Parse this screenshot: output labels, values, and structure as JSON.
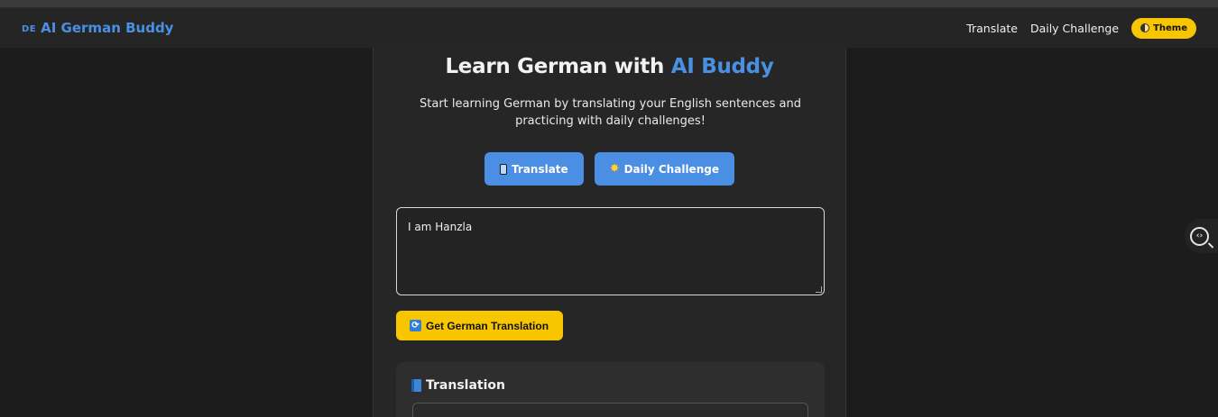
{
  "nav": {
    "brand_flag": "DE",
    "brand_name": "AI German Buddy",
    "links": [
      "Translate",
      "Daily Challenge"
    ],
    "theme_label": "Theme"
  },
  "hero": {
    "title_prefix": "Learn German with ",
    "title_accent": "AI Buddy",
    "subtitle": "Start learning German by translating your English sentences and practicing with daily challenges!"
  },
  "buttons": {
    "translate": "Translate",
    "daily_challenge": "Daily Challenge",
    "get_translation": "Get German Translation"
  },
  "input": {
    "value": "I am Hanzla"
  },
  "result": {
    "title": "Translation"
  },
  "side_tool": {
    "glyph": "‹›"
  },
  "colors": {
    "accent_blue": "#4a90e2",
    "accent_yellow": "#f7c600",
    "background": "#1c1c1c",
    "card": "#262626"
  }
}
